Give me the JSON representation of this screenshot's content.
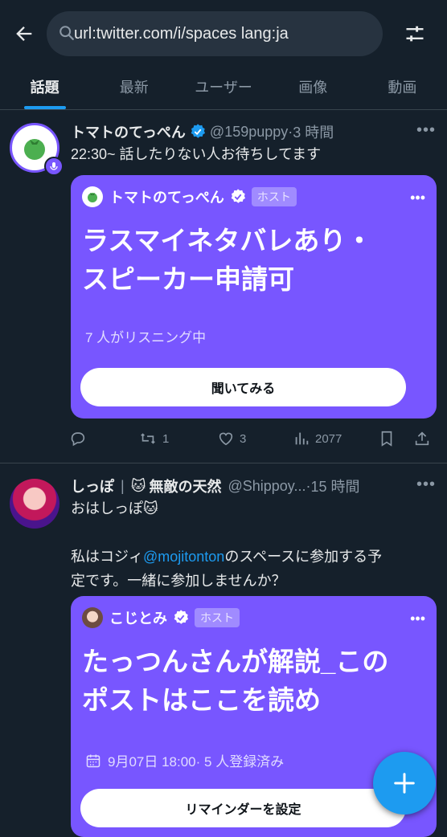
{
  "search": {
    "query": "url:twitter.com/i/spaces lang:ja"
  },
  "tabs": [
    {
      "label": "話題",
      "active": true
    },
    {
      "label": "最新",
      "active": false
    },
    {
      "label": "ユーザー",
      "active": false
    },
    {
      "label": "画像",
      "active": false
    },
    {
      "label": "動画",
      "active": false
    }
  ],
  "tweets": [
    {
      "name": "トマトのてっぺん",
      "handle": "@159puppy",
      "time": "3 時間",
      "text": "22:30~ 話したりない人お待ちしてます",
      "card": {
        "host_name": "トマトのてっぺん",
        "host_badge": "ホスト",
        "title_line1": "ラスマイネタバレあり・",
        "title_line2": "スピーカー申請可",
        "status": "7 人がリスニング中",
        "button": "聞いてみる"
      },
      "stats": {
        "retweets": "1",
        "likes": "3",
        "views": "2077"
      }
    },
    {
      "name": "しっぽ",
      "name_suffix": "無敵の天然",
      "handle": "@Shippoy...",
      "time": "15 時間",
      "text_line1": "おはしっぽ",
      "text_pre": "私はコジィ",
      "mention": "@mojitonton",
      "text_post": "のスペースに参加する予",
      "text_line3": "定です。一緒に参加しませんか？",
      "card": {
        "host_name": "こじとみ",
        "host_badge": "ホスト",
        "title_line1": "たっつんさんが解説_この",
        "title_line2": "ポストはここを読め",
        "schedule": "9月07日 18:00· 5 人登録済み",
        "button": "リマインダーを設定"
      }
    }
  ],
  "colors": {
    "background": "#15202b",
    "accent": "#1d9bf0",
    "space_card": "#7856ff",
    "verified": "#1d9bf0"
  },
  "icons": [
    "back-arrow-icon",
    "search-icon",
    "filter-icon",
    "tomato-icon",
    "spaces-mic-icon",
    "verified-icon",
    "more-icon",
    "reply-icon",
    "retweet-icon",
    "like-icon",
    "views-icon",
    "bookmark-icon",
    "share-icon",
    "calendar-icon",
    "cat-emoji-icon",
    "compose-plus-icon"
  ]
}
